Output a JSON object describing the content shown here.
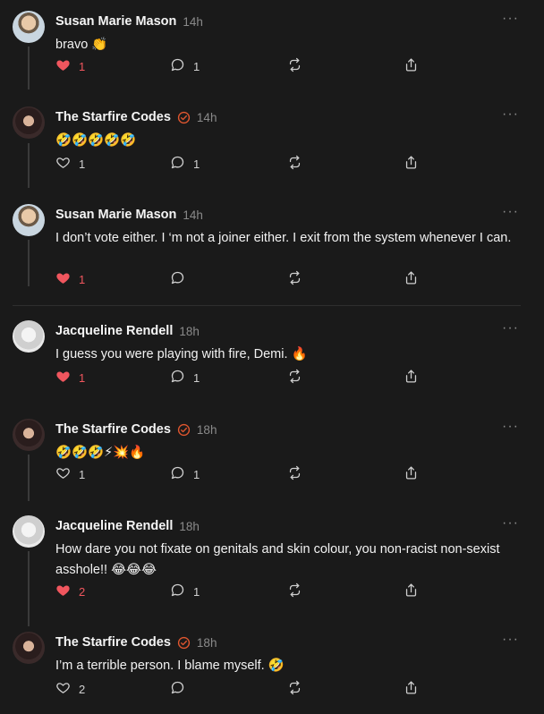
{
  "posts": [
    {
      "author": "Susan Marie Mason",
      "avatar": "susan",
      "verified": false,
      "time": "14h",
      "text": "bravo 👏",
      "liked": true,
      "likes": "1",
      "replies": "1",
      "more": "···"
    },
    {
      "author": "The Starfire Codes",
      "avatar": "starfire",
      "verified": true,
      "time": "14h",
      "text": "🤣🤣🤣🤣🤣",
      "liked": false,
      "likes": "1",
      "replies": "1",
      "more": "···"
    },
    {
      "author": "Susan Marie Mason",
      "avatar": "susan",
      "verified": false,
      "time": "14h",
      "text": "I don’t vote either. I ‘m not a joiner either. I exit from the system whenever I can.",
      "liked": true,
      "likes": "1",
      "replies": "",
      "more": "···"
    },
    {
      "author": "Jacqueline Rendell",
      "avatar": "jacq",
      "verified": false,
      "time": "18h",
      "text": "I guess you were playing with fire, Demi. 🔥",
      "liked": true,
      "likes": "1",
      "replies": "1",
      "more": "···"
    },
    {
      "author": "The Starfire Codes",
      "avatar": "starfire",
      "verified": true,
      "time": "18h",
      "text": "🤣🤣🤣⚡💥🔥",
      "liked": false,
      "likes": "1",
      "replies": "1",
      "more": "···"
    },
    {
      "author": "Jacqueline Rendell",
      "avatar": "jacq",
      "verified": false,
      "time": "18h",
      "text": "How dare you not fixate on genitals and skin colour, you non-racist non-sexist asshole!! 😂😂😂",
      "liked": true,
      "likes": "2",
      "replies": "1",
      "more": "···"
    },
    {
      "author": "The Starfire Codes",
      "avatar": "starfire",
      "verified": true,
      "time": "18h",
      "text": "I’m a terrible person. I blame myself. 🤣",
      "liked": false,
      "likes": "2",
      "replies": "",
      "more": "···"
    }
  ],
  "colors": {
    "like_active": "#f0565e",
    "verified": "#e0562f",
    "muted": "#8a8a8a"
  },
  "icons": {
    "like": "heart-icon",
    "reply": "speech-bubble-icon",
    "repost": "repost-icon",
    "share": "share-icon",
    "more": "more-icon",
    "verified": "verified-badge-icon"
  }
}
